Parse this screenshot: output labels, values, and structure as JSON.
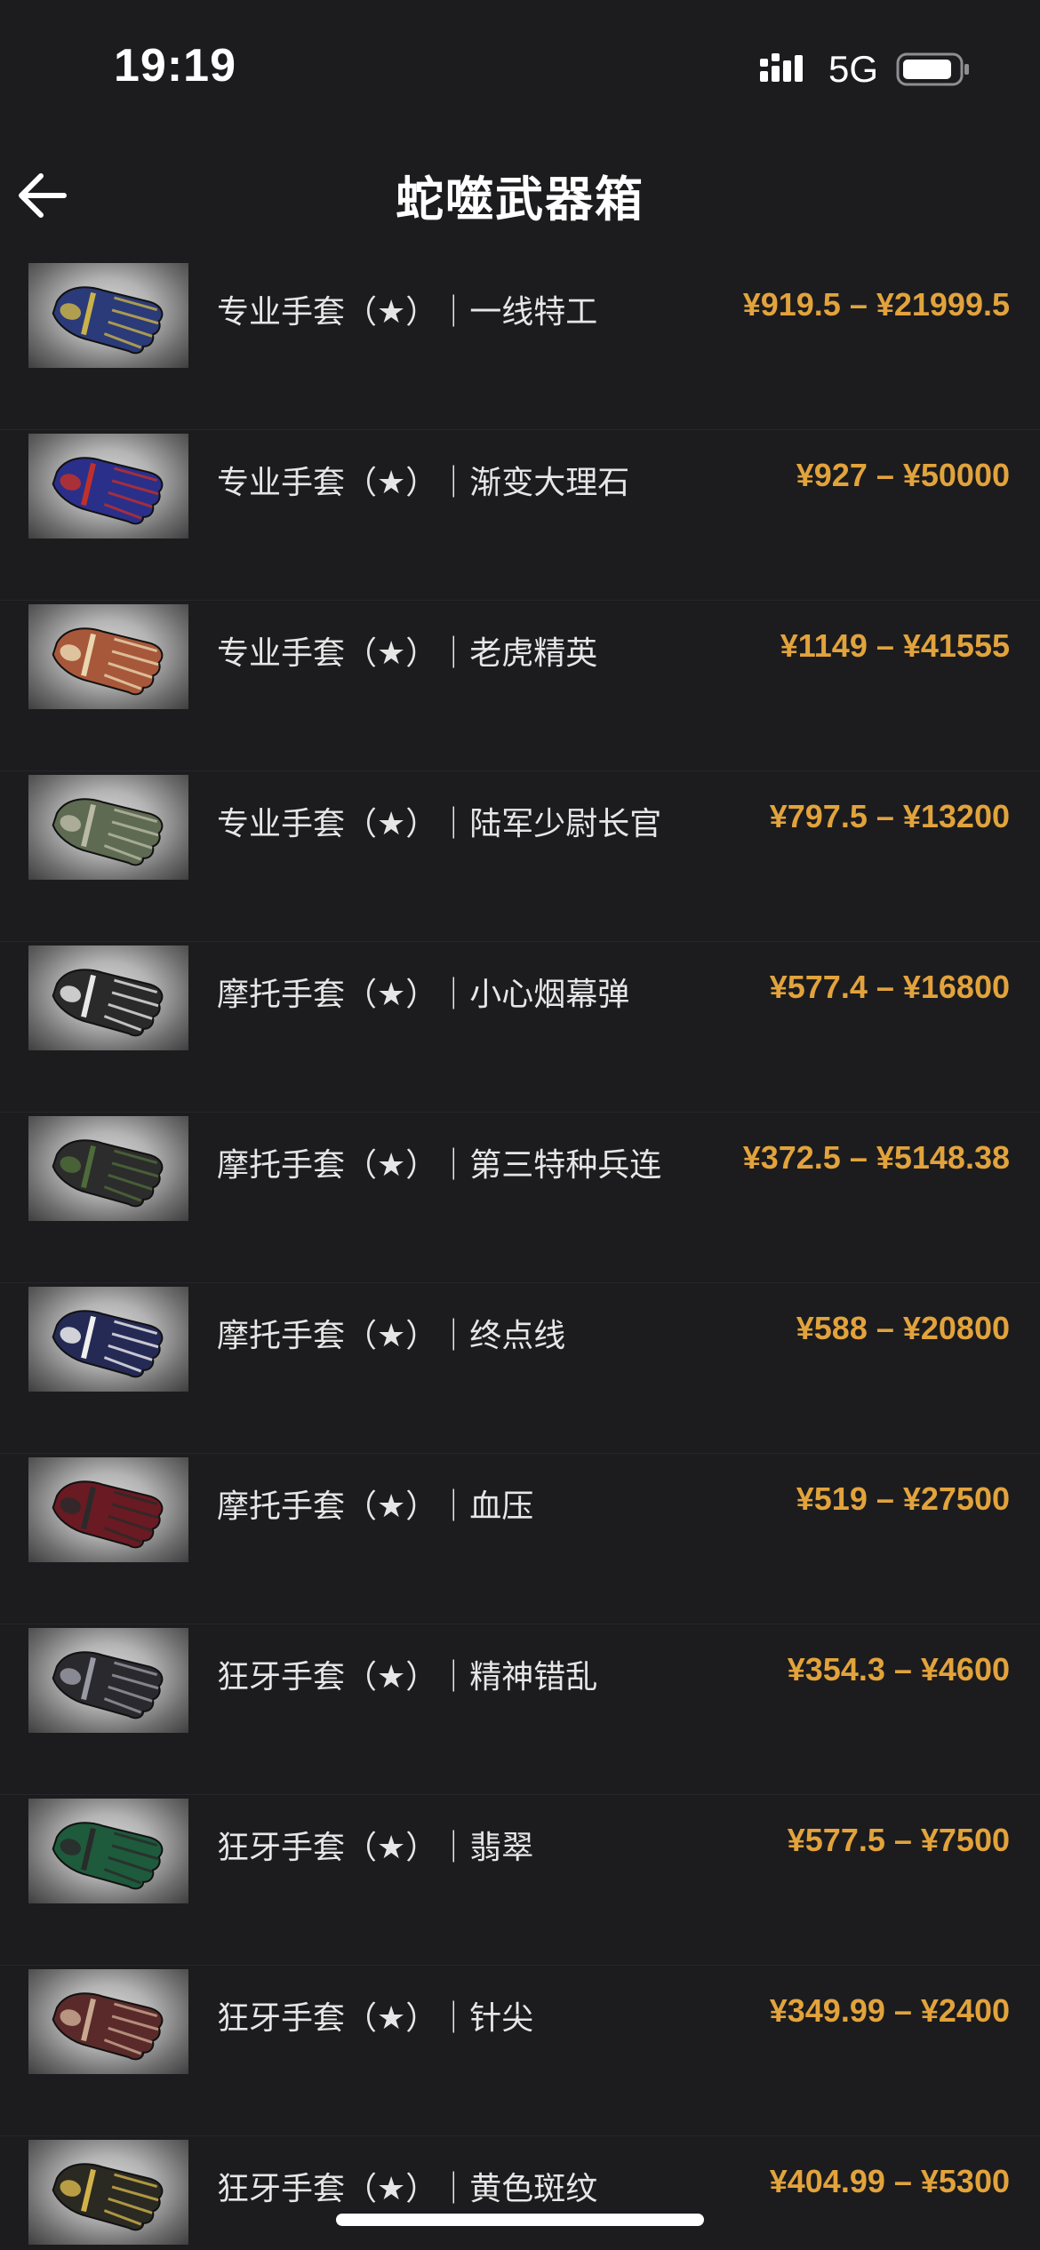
{
  "status_bar": {
    "time": "19:19",
    "network": "5G"
  },
  "nav": {
    "title": "蛇噬武器箱"
  },
  "items": [
    {
      "name": "专业手套（★）｜一线特工",
      "price": "¥919.5 – ¥21999.5",
      "glove_color": "#2b3a78",
      "accent_color": "#c9b24a"
    },
    {
      "name": "专业手套（★）｜渐变大理石",
      "price": "¥927 – ¥50000",
      "glove_color": "#2a2f8a",
      "accent_color": "#c0302a"
    },
    {
      "name": "专业手套（★）｜老虎精英",
      "price": "¥1149 – ¥41555",
      "glove_color": "#a8583a",
      "accent_color": "#e9d6b0"
    },
    {
      "name": "专业手套（★）｜陆军少尉长官",
      "price": "¥797.5 – ¥13200",
      "glove_color": "#5e6a52",
      "accent_color": "#b9b9a4"
    },
    {
      "name": "摩托手套（★）｜小心烟幕弹",
      "price": "¥577.4 – ¥16800",
      "glove_color": "#2a2a2a",
      "accent_color": "#e8e8e8"
    },
    {
      "name": "摩托手套（★）｜第三特种兵连",
      "price": "¥372.5 – ¥5148.38",
      "glove_color": "#2c2c2c",
      "accent_color": "#4e6b3a"
    },
    {
      "name": "摩托手套（★）｜终点线",
      "price": "¥588 – ¥20800",
      "glove_color": "#252a55",
      "accent_color": "#f0f0f0"
    },
    {
      "name": "摩托手套（★）｜血压",
      "price": "¥519 – ¥27500",
      "glove_color": "#6a1a22",
      "accent_color": "#2a2a2a"
    },
    {
      "name": "狂牙手套（★）｜精神错乱",
      "price": "¥354.3 – ¥4600",
      "glove_color": "#2a2a2e",
      "accent_color": "#9a9aa4"
    },
    {
      "name": "狂牙手套（★）｜翡翠",
      "price": "¥577.5 – ¥7500",
      "glove_color": "#1e5a3c",
      "accent_color": "#2a2a2a"
    },
    {
      "name": "狂牙手套（★）｜针尖",
      "price": "¥349.99 – ¥2400",
      "glove_color": "#5a2a2a",
      "accent_color": "#c8a890"
    },
    {
      "name": "狂牙手套（★）｜黄色斑纹",
      "price": "¥404.99 – ¥5300",
      "glove_color": "#2a2a22",
      "accent_color": "#d2b24a"
    }
  ],
  "icons": {
    "back": "arrow-left-icon",
    "signal": "signal-bars-icon",
    "battery": "battery-icon"
  }
}
